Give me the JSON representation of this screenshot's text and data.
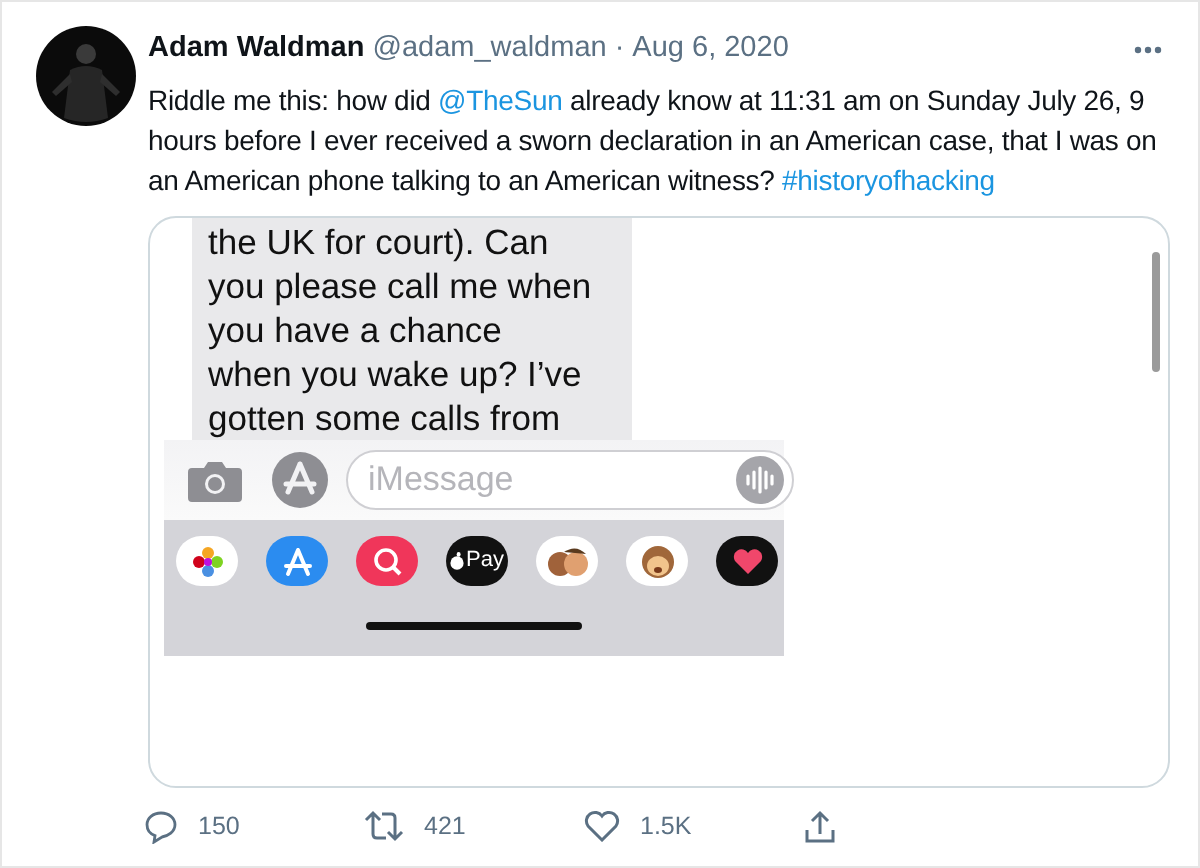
{
  "tweet": {
    "author": "Adam Waldman",
    "handle": "@adam_waldman",
    "separator": "·",
    "date": "Aug 6, 2020",
    "text": [
      {
        "kind": "text",
        "value": "Riddle me this: how did "
      },
      {
        "kind": "link",
        "value": "@TheSun"
      },
      {
        "kind": "text",
        "value": " already know at 11:31 am on Sunday July 26, 9 hours before I ever received a sworn declaration in an American case, that I was on an American phone talking to an American witness? "
      },
      {
        "kind": "link",
        "value": "#historyofhacking"
      }
    ],
    "media": {
      "bubble_lines": [
        "the UK for court). Can",
        "you please call me when",
        "you have a chance",
        "when you wake up? I’ve",
        "gotten some calls from"
      ],
      "input_placeholder": "iMessage",
      "apps": [
        {
          "kind": "photos"
        },
        {
          "kind": "appstore"
        },
        {
          "kind": "search"
        },
        {
          "kind": "pay",
          "label": "Pay"
        },
        {
          "kind": "memoji"
        },
        {
          "kind": "monkey"
        },
        {
          "kind": "heart"
        }
      ]
    },
    "actions": [
      {
        "kind": "reply",
        "count": "150"
      },
      {
        "kind": "retweet",
        "count": "421"
      },
      {
        "kind": "like",
        "count": "1.5K"
      },
      {
        "kind": "share"
      }
    ]
  }
}
